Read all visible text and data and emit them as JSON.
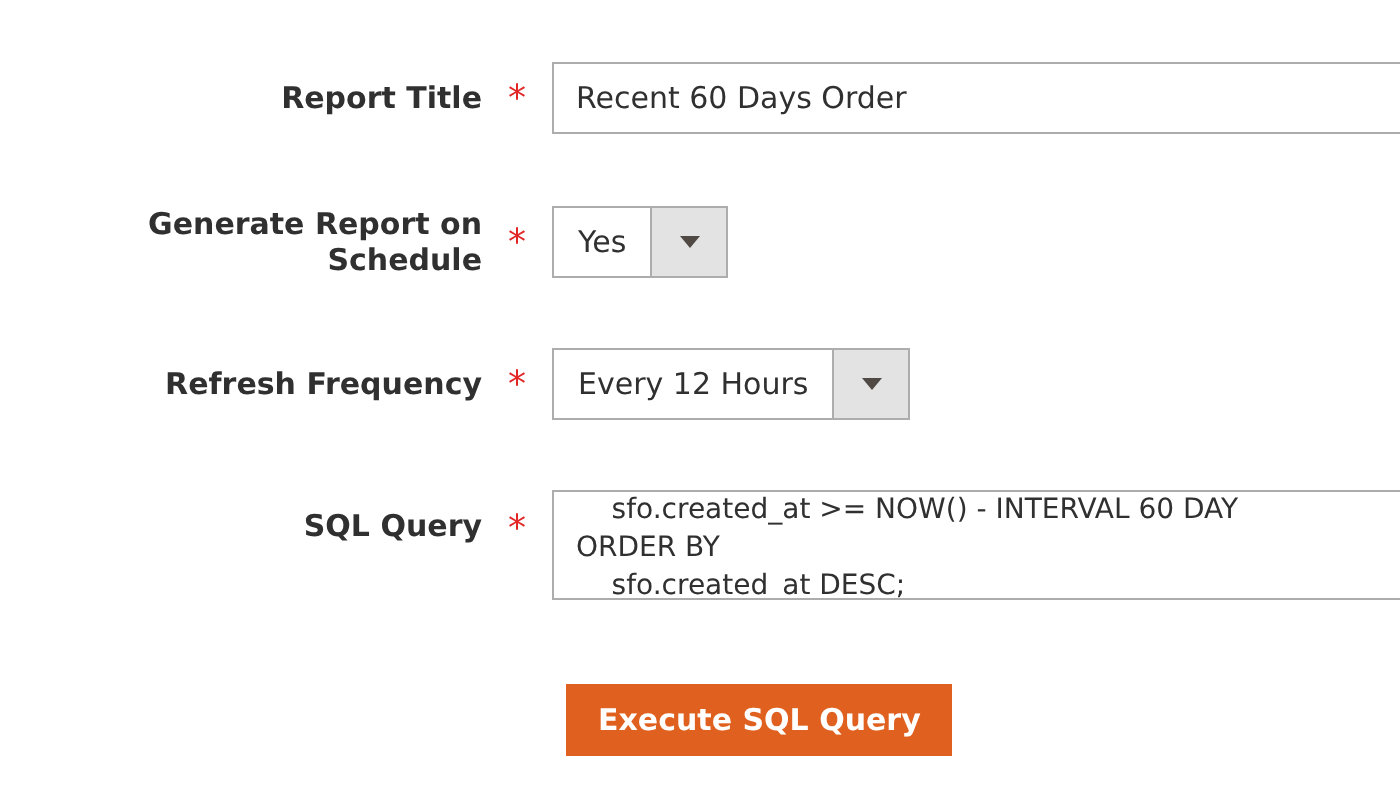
{
  "fields": [
    {
      "label": "Report Title",
      "required_mark": "*",
      "kind": "input",
      "value": "Recent 60 Days Order"
    },
    {
      "label": "Generate Report on Schedule",
      "required_mark": "*",
      "kind": "select",
      "value": "Yes"
    },
    {
      "label": "Refresh Frequency",
      "required_mark": "*",
      "kind": "select",
      "value": "Every 12 Hours"
    },
    {
      "label": "SQL Query",
      "required_mark": "*",
      "kind": "textarea",
      "lines": [
        "    sfo.created_at >= NOW() - INTERVAL 60 DAY",
        "ORDER BY",
        "    sfo.created_at DESC;"
      ]
    }
  ],
  "button": "Execute SQL Query"
}
